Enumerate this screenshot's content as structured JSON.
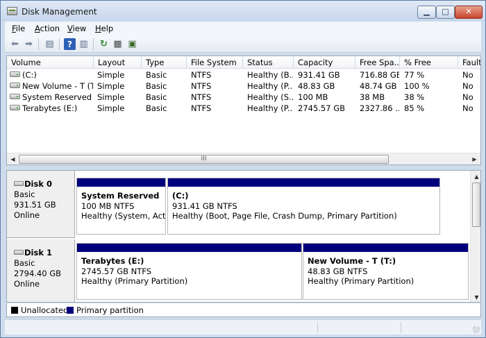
{
  "window": {
    "title": "Disk Management"
  },
  "menu": [
    "File",
    "Action",
    "View",
    "Help"
  ],
  "toolbar": [
    {
      "name": "back-icon",
      "glyph": "⬅"
    },
    {
      "name": "forward-icon",
      "glyph": "➡"
    },
    {
      "name": "console-tree-icon",
      "glyph": "▤"
    },
    {
      "name": "help-icon",
      "glyph": "?"
    },
    {
      "name": "action-pane-icon",
      "glyph": "▥"
    },
    {
      "name": "refresh-icon",
      "glyph": "↻"
    },
    {
      "name": "properties-icon",
      "glyph": "▦"
    },
    {
      "name": "rescan-disks-icon",
      "glyph": "▣"
    }
  ],
  "volume_table": {
    "columns": [
      "Volume",
      "Layout",
      "Type",
      "File System",
      "Status",
      "Capacity",
      "Free Spa...",
      "% Free",
      "Fault"
    ],
    "rows": [
      [
        "(C:)",
        "Simple",
        "Basic",
        "NTFS",
        "Healthy (B...",
        "931.41 GB",
        "716.88 GB",
        "77 %",
        "No"
      ],
      [
        "New Volume - T (T:)",
        "Simple",
        "Basic",
        "NTFS",
        "Healthy (P...",
        "48.83 GB",
        "48.74 GB",
        "100 %",
        "No"
      ],
      [
        "System Reserved",
        "Simple",
        "Basic",
        "NTFS",
        "Healthy (S...",
        "100 MB",
        "38 MB",
        "38 %",
        "No"
      ],
      [
        "Terabytes (E:)",
        "Simple",
        "Basic",
        "NTFS",
        "Healthy (P...",
        "2745.57 GB",
        "2327.86 ...",
        "85 %",
        "No"
      ]
    ],
    "scroll_thumb_label": "III"
  },
  "disks": [
    {
      "name": "Disk 0",
      "type": "Basic",
      "size": "931.51 GB",
      "status": "Online",
      "partitions": [
        {
          "title": "System Reserved",
          "size": "100 MB NTFS",
          "status": "Healthy (System, Active"
        },
        {
          "title": "(C:)",
          "size": "931.41 GB NTFS",
          "status": "Healthy (Boot, Page File, Crash Dump, Primary Partition)"
        }
      ]
    },
    {
      "name": "Disk 1",
      "type": "Basic",
      "size": "2794.40 GB",
      "status": "Online",
      "partitions": [
        {
          "title": "Terabytes  (E:)",
          "size": "2745.57 GB NTFS",
          "status": "Healthy (Primary Partition)"
        },
        {
          "title": "New Volume - T  (T:)",
          "size": "48.83 GB NTFS",
          "status": "Healthy (Primary Partition)"
        }
      ]
    }
  ],
  "legend": [
    {
      "label": "Unallocated",
      "color": "#000000"
    },
    {
      "label": "Primary partition",
      "color": "#00007d"
    }
  ],
  "colors": {
    "partition_bar": "#00007d",
    "unallocated": "#000000"
  }
}
